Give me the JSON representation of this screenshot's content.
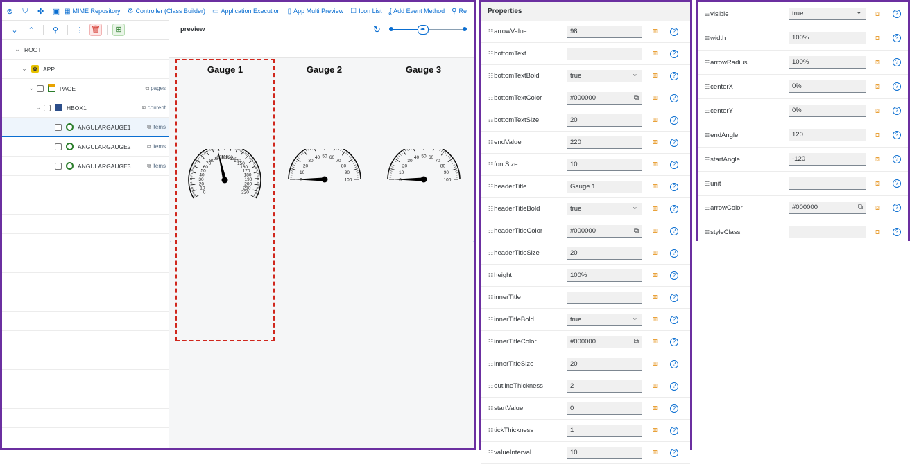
{
  "toolbar": {
    "links": [
      {
        "icon": "mime-repository-icon",
        "label": "MIME Repository"
      },
      {
        "icon": "controller-icon",
        "label": "Controller (Class Builder)"
      },
      {
        "icon": "app-execution-icon",
        "label": "Application Execution"
      },
      {
        "icon": "multi-preview-icon",
        "label": "App Multi Preview"
      },
      {
        "icon": "icon-list-icon",
        "label": "Icon List"
      },
      {
        "icon": "event-method-icon",
        "label": "Add Event Method"
      },
      {
        "icon": "more-icon",
        "label": "Re"
      }
    ]
  },
  "tree": {
    "nodes": [
      {
        "label": "ROOT",
        "agg": ""
      },
      {
        "label": "APP",
        "agg": ""
      },
      {
        "label": "PAGE",
        "agg": "pages"
      },
      {
        "label": "HBOX1",
        "agg": "content"
      },
      {
        "label": "ANGULARGAUGE1",
        "agg": "items"
      },
      {
        "label": "ANGULARGAUGE2",
        "agg": "items"
      },
      {
        "label": "ANGULARGAUGE3",
        "agg": "items"
      }
    ]
  },
  "preview": {
    "title": "preview",
    "zoom_fraction": 0.42,
    "gauges": [
      {
        "title": "Gauge 1",
        "start": 0,
        "end": 220,
        "interval": 10,
        "value": 98,
        "tick_labels": [
          "0",
          "10",
          "20",
          "30",
          "40",
          "50",
          "60",
          "70",
          "80",
          "90",
          "100",
          "110",
          "120",
          "130",
          "140",
          "150",
          "160",
          "170",
          "180",
          "190",
          "200",
          "210",
          "220"
        ]
      },
      {
        "title": "Gauge 2",
        "start": 0,
        "end": 100,
        "interval": 10,
        "value": 0,
        "tick_labels": [
          "0",
          "10",
          "20",
          "30",
          "40",
          "50",
          "60",
          "70",
          "80",
          "90",
          "100"
        ]
      },
      {
        "title": "Gauge 3",
        "start": 0,
        "end": 100,
        "interval": 10,
        "value": 0,
        "tick_labels": [
          "0",
          "10",
          "20",
          "30",
          "40",
          "50",
          "60",
          "70",
          "80",
          "90",
          "100"
        ]
      }
    ]
  },
  "properties": {
    "title": "Properties",
    "rows": [
      {
        "name": "arrowValue",
        "value": "98",
        "kind": "input"
      },
      {
        "name": "bottomText",
        "value": "",
        "kind": "input"
      },
      {
        "name": "bottomTextBold",
        "value": "true",
        "kind": "select"
      },
      {
        "name": "bottomTextColor",
        "value": "#000000",
        "kind": "color"
      },
      {
        "name": "bottomTextSize",
        "value": "20",
        "kind": "input"
      },
      {
        "name": "endValue",
        "value": "220",
        "kind": "input"
      },
      {
        "name": "fontSize",
        "value": "10",
        "kind": "input"
      },
      {
        "name": "headerTitle",
        "value": "Gauge 1",
        "kind": "input"
      },
      {
        "name": "headerTitleBold",
        "value": "true",
        "kind": "select"
      },
      {
        "name": "headerTitleColor",
        "value": "#000000",
        "kind": "color"
      },
      {
        "name": "headerTitleSize",
        "value": "20",
        "kind": "input"
      },
      {
        "name": "height",
        "value": "100%",
        "kind": "input"
      },
      {
        "name": "innerTitle",
        "value": "",
        "kind": "input"
      },
      {
        "name": "innerTitleBold",
        "value": "true",
        "kind": "select"
      },
      {
        "name": "innerTitleColor",
        "value": "#000000",
        "kind": "color"
      },
      {
        "name": "innerTitleSize",
        "value": "20",
        "kind": "input"
      },
      {
        "name": "outlineThickness",
        "value": "2",
        "kind": "input"
      },
      {
        "name": "startValue",
        "value": "0",
        "kind": "input"
      },
      {
        "name": "tickThickness",
        "value": "1",
        "kind": "input"
      },
      {
        "name": "valueInterval",
        "value": "10",
        "kind": "input"
      }
    ],
    "rows2": [
      {
        "name": "visible",
        "value": "true",
        "kind": "select"
      },
      {
        "name": "width",
        "value": "100%",
        "kind": "input"
      },
      {
        "name": "arrowRadius",
        "value": "100%",
        "kind": "input"
      },
      {
        "name": "centerX",
        "value": "0%",
        "kind": "input"
      },
      {
        "name": "centerY",
        "value": "0%",
        "kind": "input"
      },
      {
        "name": "endAngle",
        "value": "120",
        "kind": "input"
      },
      {
        "name": "startAngle",
        "value": "-120",
        "kind": "input"
      },
      {
        "name": "unit",
        "value": "",
        "kind": "input"
      },
      {
        "name": "arrowColor",
        "value": "#000000",
        "kind": "color"
      },
      {
        "name": "styleClass",
        "value": "",
        "kind": "input"
      }
    ]
  },
  "colors": {
    "accent": "#0a6ed1",
    "frame": "#6b2fa0",
    "selection": "#d0271d",
    "folder": "#e9a23b"
  }
}
